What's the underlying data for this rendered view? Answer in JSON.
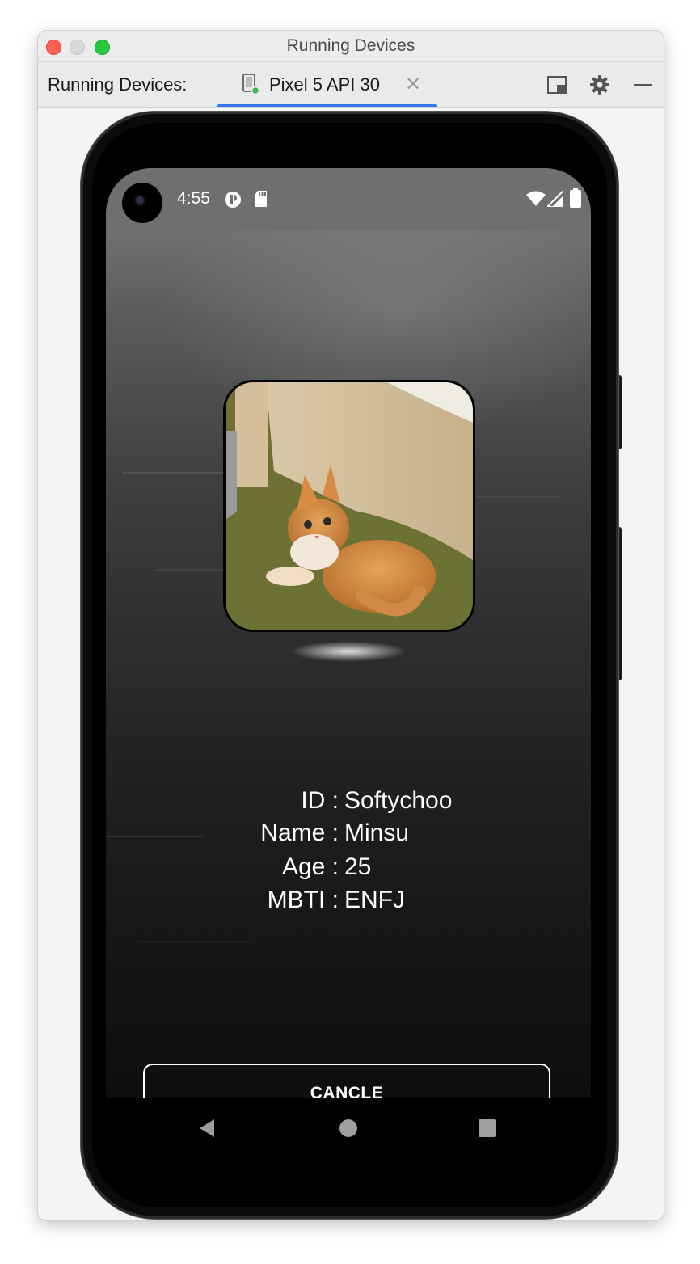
{
  "window": {
    "title": "Running Devices"
  },
  "toolbar": {
    "running_devices_label": "Running Devices:",
    "tab_label": "Pixel 5 API 30",
    "tab_close": "✕",
    "accent_color": "#3574f0"
  },
  "statusbar": {
    "time": "4:55",
    "icons": [
      "notification-icon",
      "sd-card-icon",
      "wifi-icon",
      "cellular-icon",
      "battery-icon"
    ]
  },
  "profile": {
    "image": "kitten-photo",
    "rows": [
      {
        "key": "ID :",
        "value": "Softychoo"
      },
      {
        "key": "Name :",
        "value": "Minsu"
      },
      {
        "key": "Age :",
        "value": "25"
      },
      {
        "key": "MBTI :",
        "value": "ENFJ"
      }
    ]
  },
  "actions": {
    "cancel_label": "CANCLE"
  },
  "navbar": {
    "icons": [
      "back-icon",
      "home-icon",
      "recents-icon"
    ]
  }
}
